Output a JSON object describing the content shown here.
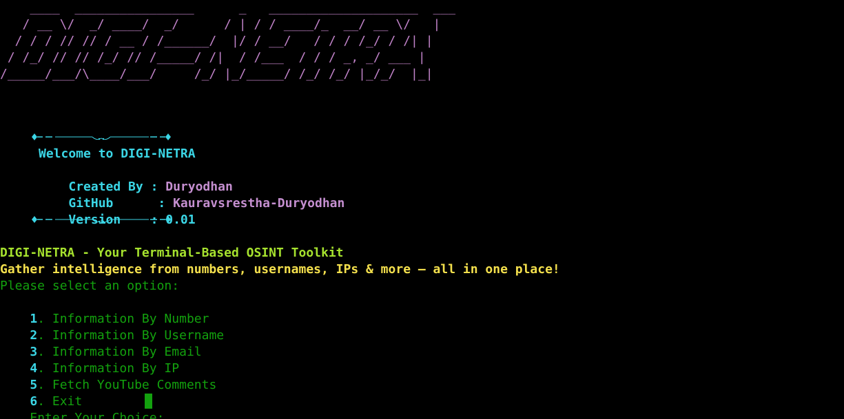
{
  "banner": {
    "ascii_art": "    ____  ________________      _   ____________________  ___\n   / __ \\/  _/ ____/  _/      / | / / ____/_  __/ __ \\/   |\n  / / / // // / __ / /______/  |/ / __/   / / / /_/ / /| |\n / /_/ // // /_/ // /_____/ /|  / /___  / / / _, _/ ___ |\n/_____/___/\\____/___/     /_/ |_/_____/ /_/ /_/ |_/_/  |_|"
  },
  "info_box": {
    "welcome": "Welcome to DIGI-NETRA",
    "created_by_label": "Created By : ",
    "created_by_value": "Duryodhan",
    "github_label": "GitHub      : ",
    "github_value": "Kauravsrestha-Duryodhan",
    "version_label": "Version    : ",
    "version_value": "0.01"
  },
  "tagline": "DIGI-NETRA - Your Terminal-Based OSINT Toolkit",
  "subtitle": "Gather intelligence from numbers, usernames, IPs & more — all in one place!",
  "menu": {
    "prompt": "Please select an option:",
    "options": [
      {
        "number": "1",
        "label": ". Information By Number"
      },
      {
        "number": "2",
        "label": ". Information By Username"
      },
      {
        "number": "3",
        "label": ". Information By Email"
      },
      {
        "number": "4",
        "label": ". Information By IP"
      },
      {
        "number": "5",
        "label": ". Fetch YouTube Comments"
      },
      {
        "number": "6",
        "label": ". Exit"
      }
    ]
  },
  "input": {
    "prompt": "Enter Your Choice: ",
    "value": ""
  },
  "colors": {
    "background": "#000000",
    "banner": "#c082c8",
    "accent_cyan": "#3bd6e6",
    "tagline_lime": "#a6e22e",
    "subtitle_yellow": "#f4e04d",
    "menu_green": "#13a10e"
  }
}
